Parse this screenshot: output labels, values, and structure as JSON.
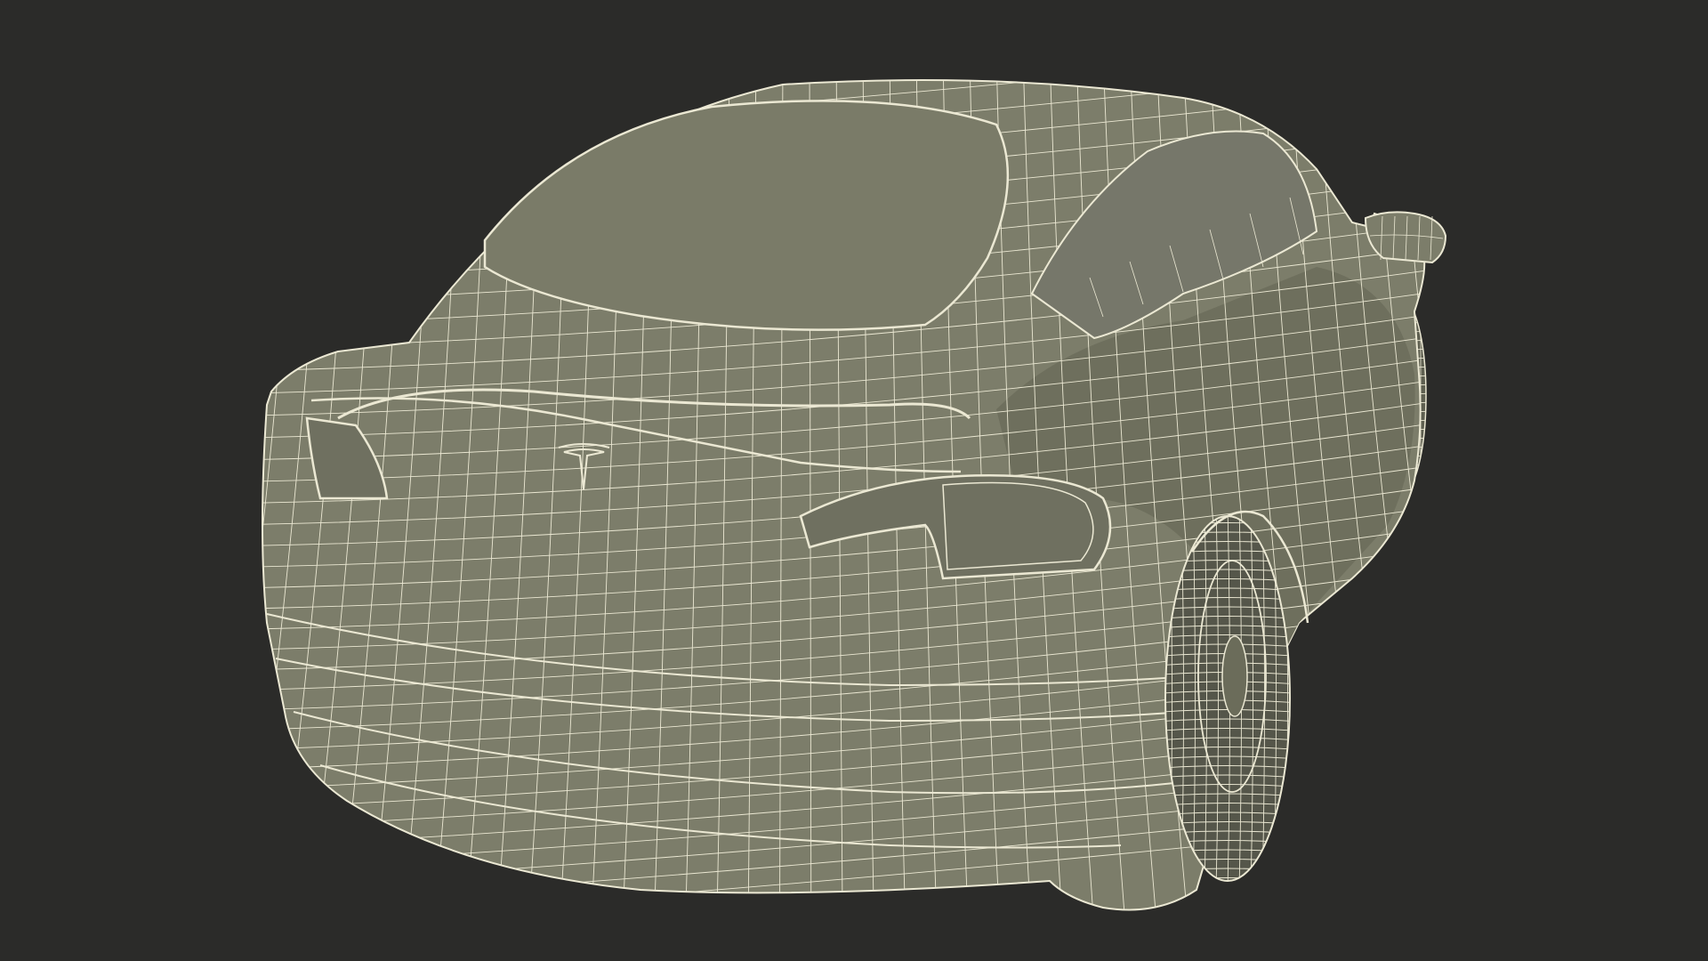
{
  "scene": {
    "subject": "",
    "background_color": "#2b2b29",
    "body_fill_color": "#7c7d6a",
    "body_shade_color": "#6b6c5a",
    "wire_color": "#ebe8d3",
    "wire_dark_color": "#cfccb6",
    "tire_color": "#55564a"
  }
}
